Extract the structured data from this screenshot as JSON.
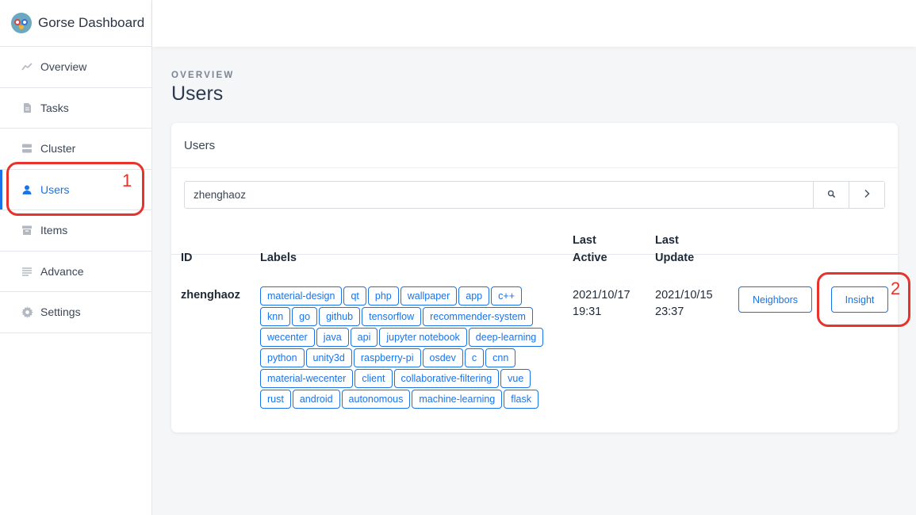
{
  "brand": {
    "title": "Gorse Dashboard"
  },
  "sidebar": {
    "items": [
      {
        "label": "Overview",
        "icon": "trend-line-icon"
      },
      {
        "label": "Tasks",
        "icon": "document-icon"
      },
      {
        "label": "Cluster",
        "icon": "server-icon"
      },
      {
        "label": "Users",
        "icon": "user-icon",
        "active": true
      },
      {
        "label": "Items",
        "icon": "archive-icon"
      },
      {
        "label": "Advance",
        "icon": "list-icon"
      },
      {
        "label": "Settings",
        "icon": "gear-icon"
      }
    ]
  },
  "page": {
    "pretitle": "OVERVIEW",
    "title": "Users"
  },
  "card": {
    "title": "Users",
    "search": {
      "value": "zhenghaoz",
      "search_icon": "search-icon",
      "next_icon": "chevron-right-icon"
    }
  },
  "table": {
    "headers": {
      "id": "ID",
      "labels": "Labels",
      "last_active_1": "Last",
      "last_active_2": "Active",
      "last_update_1": "Last",
      "last_update_2": "Update"
    },
    "row": {
      "id": "zhenghaoz",
      "last_active_date": "2021/10/17",
      "last_active_time": "19:31",
      "last_update_date": "2021/10/15",
      "last_update_time": "23:37",
      "neighbors_label": "Neighbors",
      "insight_label": "Insight",
      "labels": [
        [
          "material-design",
          "qt",
          "php",
          "wallpaper",
          "app",
          "c++"
        ],
        [
          "knn",
          "go",
          "github",
          "tensorflow",
          "recommender-system"
        ],
        [
          "wecenter",
          "java",
          "api",
          "jupyter notebook",
          "deep-learning"
        ],
        [
          "python",
          "unity3d",
          "raspberry-pi",
          "osdev",
          "c",
          "cnn"
        ],
        [
          "material-wecenter",
          "client",
          "collaborative-filtering",
          "vue"
        ],
        [
          "rust",
          "android",
          "autonomous",
          "machine-learning",
          "flask"
        ]
      ]
    }
  },
  "annotations": {
    "one": "1",
    "two": "2"
  },
  "colors": {
    "accent": "#1a73e8",
    "annotation": "#e8322c"
  }
}
